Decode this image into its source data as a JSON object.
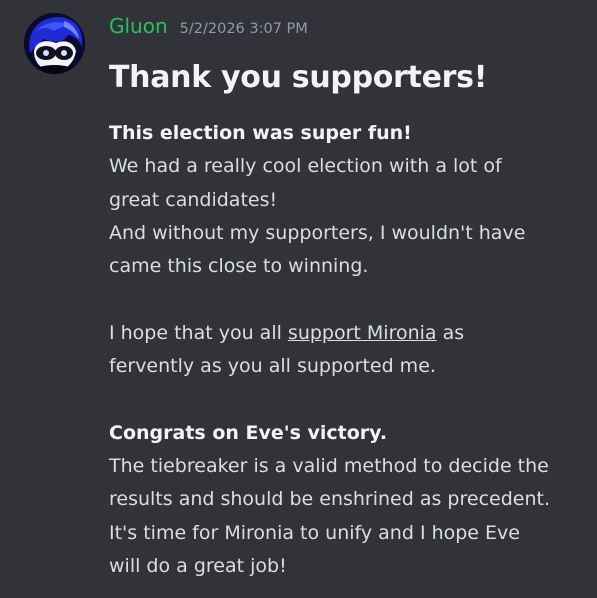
{
  "message": {
    "author": {
      "username": "Gluon",
      "avatar_icon": "anime-character-avatar-icon",
      "name_color": "#23c45a"
    },
    "timestamp": "5/2/2026 3:07 PM",
    "title": "Thank you supporters!",
    "sections": [
      {
        "heading": "This election was super fun!",
        "lines": [
          "We had a really cool election with a lot of",
          "great candidates!",
          "And without my supporters, I wouldn't have",
          "came this close to winning."
        ]
      },
      {
        "line1_before": "I hope that you all ",
        "link_text": "support Mironia",
        "line1_after": " as",
        "line2": "fervently as you all supported me."
      },
      {
        "heading": "Congrats on Eve's victory.",
        "lines": [
          "The tiebreaker is a valid method to decide the",
          "results and should be enshrined as precedent.",
          "It's time for Mironia to unify and I hope Eve",
          "will do a great job!"
        ]
      }
    ]
  },
  "theme": {
    "background": "#313338",
    "text": "#dbdee1",
    "muted": "#949ba4"
  }
}
